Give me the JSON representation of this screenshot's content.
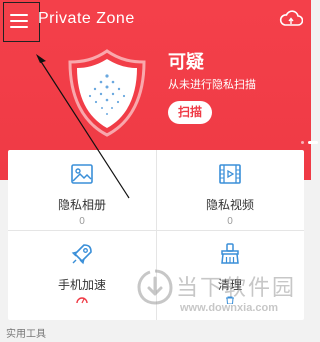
{
  "header": {
    "app_title": "Private Zone",
    "status_title": "可疑",
    "status_desc": "从未进行隐私扫描",
    "scan_label": "扫描"
  },
  "icons": {
    "menu": "hamburger-menu-icon",
    "cloud": "cloud-icon",
    "shield": "shield-icon"
  },
  "grid": {
    "items": [
      {
        "label": "隐私相册",
        "count": "0",
        "icon": "photo-icon"
      },
      {
        "label": "隐私视频",
        "count": "0",
        "icon": "video-icon"
      },
      {
        "label": "手机加速",
        "count": "",
        "icon": "rocket-icon"
      },
      {
        "label": "清理",
        "count": "",
        "icon": "brush-icon"
      }
    ]
  },
  "footer": {
    "section_label": "实用工具"
  },
  "watermark": {
    "name": "当下软件园",
    "url": "www.downxia.com"
  },
  "colors": {
    "brand_red": "#ef3a45",
    "icon_blue": "#3a8fd8",
    "background": "#f2f2f2"
  }
}
